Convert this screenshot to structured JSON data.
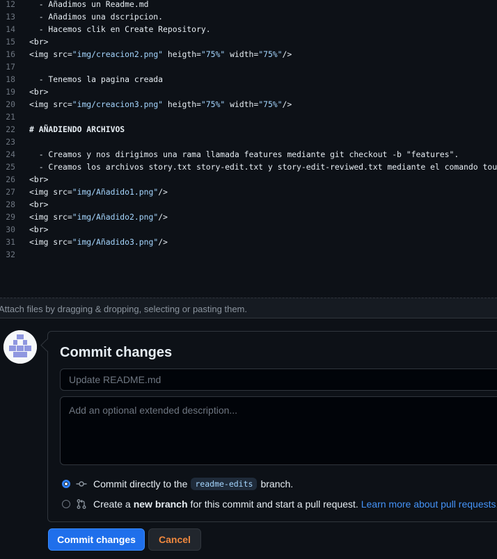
{
  "editor": {
    "lines": [
      {
        "n": "12",
        "segments": [
          {
            "t": "  - Añadimos un Readme.md"
          }
        ]
      },
      {
        "n": "13",
        "segments": [
          {
            "t": "  - Añadimos una dscripcion."
          }
        ]
      },
      {
        "n": "14",
        "segments": [
          {
            "t": "  - Hacemos clik en Create Repository."
          }
        ]
      },
      {
        "n": "15",
        "segments": [
          {
            "t": "<br>"
          }
        ]
      },
      {
        "n": "16",
        "segments": [
          {
            "t": "<img src="
          },
          {
            "t": "\"img/creacion2.png\"",
            "c": "str"
          },
          {
            "t": " heigth="
          },
          {
            "t": "\"75%\"",
            "c": "str"
          },
          {
            "t": " width="
          },
          {
            "t": "\"75%\"",
            "c": "str"
          },
          {
            "t": "/>"
          }
        ]
      },
      {
        "n": "17",
        "segments": [
          {
            "t": ""
          }
        ]
      },
      {
        "n": "18",
        "segments": [
          {
            "t": "  - Tenemos la pagina creada"
          }
        ]
      },
      {
        "n": "19",
        "segments": [
          {
            "t": "<br>"
          }
        ]
      },
      {
        "n": "20",
        "segments": [
          {
            "t": "<img src="
          },
          {
            "t": "\"img/creacion3.png\"",
            "c": "str"
          },
          {
            "t": " heigth="
          },
          {
            "t": "\"75%\"",
            "c": "str"
          },
          {
            "t": " width="
          },
          {
            "t": "\"75%\"",
            "c": "str"
          },
          {
            "t": "/>"
          }
        ]
      },
      {
        "n": "21",
        "segments": [
          {
            "t": ""
          }
        ]
      },
      {
        "n": "22",
        "segments": [
          {
            "t": "# AÑADIENDO ARCHIVOS",
            "c": "hd"
          }
        ]
      },
      {
        "n": "23",
        "segments": [
          {
            "t": ""
          }
        ]
      },
      {
        "n": "24",
        "segments": [
          {
            "t": "  - Creamos y nos dirigimos una rama llamada features mediante git checkout -b \"features\"."
          }
        ]
      },
      {
        "n": "25",
        "segments": [
          {
            "t": "  - Creamos los archivos story.txt story-edit.txt y story-edit-reviwed.txt mediante el comando touch."
          }
        ]
      },
      {
        "n": "26",
        "segments": [
          {
            "t": "<br>"
          }
        ]
      },
      {
        "n": "27",
        "segments": [
          {
            "t": "<img src="
          },
          {
            "t": "\"img/Añadido1.png\"",
            "c": "str"
          },
          {
            "t": "/>"
          }
        ]
      },
      {
        "n": "28",
        "segments": [
          {
            "t": "<br>"
          }
        ]
      },
      {
        "n": "29",
        "segments": [
          {
            "t": "<img src="
          },
          {
            "t": "\"img/Añadido2.png\"",
            "c": "str"
          },
          {
            "t": "/>"
          }
        ]
      },
      {
        "n": "30",
        "segments": [
          {
            "t": "<br>"
          }
        ]
      },
      {
        "n": "31",
        "segments": [
          {
            "t": "<img src="
          },
          {
            "t": "\"img/Añadido3.png\"",
            "c": "str"
          },
          {
            "t": "/>"
          }
        ]
      },
      {
        "n": "32",
        "segments": [
          {
            "t": ""
          }
        ]
      }
    ]
  },
  "attach": {
    "text": "Attach files by dragging & dropping, selecting or pasting them."
  },
  "commit": {
    "title": "Commit changes",
    "summary_placeholder": "Update README.md",
    "summary_value": "",
    "description_placeholder": "Add an optional extended description...",
    "option_direct": {
      "prefix": "Commit directly to the",
      "branch": "readme-edits",
      "suffix": "branch.",
      "selected": true
    },
    "option_new_branch": {
      "prefix": "Create a",
      "strong": "new branch",
      "suffix": "for this commit and start a pull request.",
      "link": "Learn more about pull requests.",
      "selected": false
    },
    "commit_button": "Commit changes",
    "cancel_button": "Cancel"
  },
  "icons": {
    "avatar": "identicon",
    "commit_icon": "git-commit-icon",
    "pull_request_icon": "git-pull-request-icon"
  },
  "colors": {
    "background": "#0d1117",
    "accent": "#1f6feb",
    "link": "#4493f8",
    "string": "#a5d6ff",
    "cancel": "#f0883e"
  }
}
